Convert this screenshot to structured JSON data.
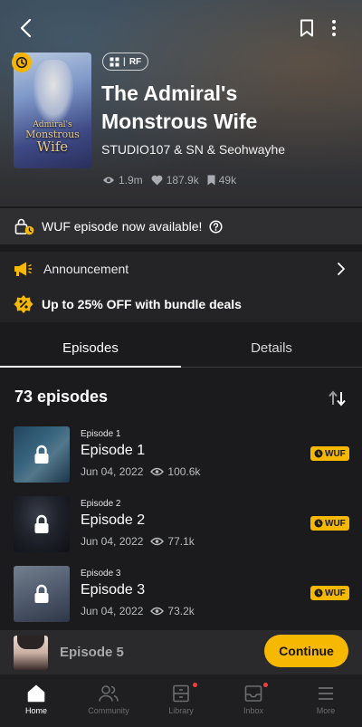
{
  "header": {
    "tag_label": "RF",
    "title_line1": "The Admiral's",
    "title_line2": "Monstrous Wife",
    "authors": "STUDIO107 & SN & Seohwayhe",
    "stats": {
      "views": "1.9m",
      "likes": "187.9k",
      "subscribers": "49k"
    },
    "cover_title": {
      "line1": "Admiral's",
      "line2": "Monstrous",
      "line3": "Wife"
    }
  },
  "notice": {
    "wuf_text": "WUF episode now available!"
  },
  "announcement": {
    "label": "Announcement"
  },
  "bundle": {
    "label": "Up to 25% OFF with bundle deals"
  },
  "tabs": [
    {
      "label": "Episodes",
      "active": true
    },
    {
      "label": "Details",
      "active": false
    }
  ],
  "episode_count": "73 episodes",
  "episodes": [
    {
      "label": "Episode 1",
      "title": "Episode 1",
      "date": "Jun 04, 2022",
      "views": "100.6k",
      "badge": "WUF"
    },
    {
      "label": "Episode 2",
      "title": "Episode 2",
      "date": "Jun 04, 2022",
      "views": "77.1k",
      "badge": "WUF"
    },
    {
      "label": "Episode 3",
      "title": "Episode 3",
      "date": "Jun 04, 2022",
      "views": "73.2k",
      "badge": "WUF"
    }
  ],
  "continue_bar": {
    "episode": "Episode 5",
    "button": "Continue"
  },
  "nav": [
    {
      "label": "Home",
      "active": true
    },
    {
      "label": "Community",
      "active": false
    },
    {
      "label": "Library",
      "active": false
    },
    {
      "label": "Inbox",
      "active": false
    },
    {
      "label": "More",
      "active": false
    }
  ],
  "colors": {
    "accent": "#f6b800",
    "background": "#1b1b1d",
    "notification": "#ff3b3b"
  }
}
